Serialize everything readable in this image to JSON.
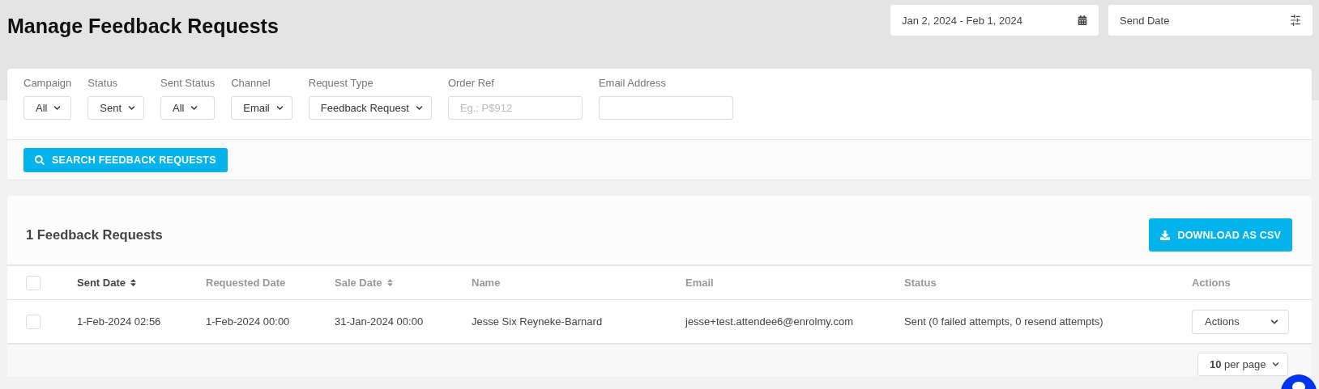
{
  "page": {
    "title": "Manage Feedback Requests"
  },
  "date_range": {
    "value": "Jan 2, 2024 - Feb 1, 2024"
  },
  "date_type": {
    "value": "Send Date"
  },
  "filters": [
    {
      "kind": "select",
      "label": "Campaign",
      "value": "All"
    },
    {
      "kind": "select",
      "label": "Status",
      "value": "Sent"
    },
    {
      "kind": "select",
      "label": "Sent Status",
      "value": "All"
    },
    {
      "kind": "select",
      "label": "Channel",
      "value": "Email"
    },
    {
      "kind": "select",
      "label": "Request Type",
      "value": "Feedback Request"
    },
    {
      "kind": "text",
      "label": "Order Ref",
      "placeholder": "Eg.: P$912"
    },
    {
      "kind": "text",
      "label": "Email Address"
    }
  ],
  "search_button": "SEARCH FEEDBACK REQUESTS",
  "results": {
    "title": "1 Feedback Requests",
    "download_button": "DOWNLOAD AS CSV",
    "select_all": {
      "checked": false
    },
    "columns": [
      {
        "label": "Sent Date",
        "sortable": true,
        "active": true
      },
      {
        "label": "Requested Date",
        "sortable": false,
        "active": false
      },
      {
        "label": "Sale Date",
        "sortable": true,
        "active": false
      },
      {
        "label": "Name",
        "sortable": false,
        "active": false
      },
      {
        "label": "Email",
        "sortable": false,
        "active": false
      },
      {
        "label": "Status",
        "sortable": false,
        "active": false
      },
      {
        "label": "Actions",
        "sortable": false,
        "active": false
      }
    ],
    "rows": [
      {
        "checked": false,
        "cells": [
          "1-Feb-2024 02:56",
          "1-Feb-2024 00:00",
          "31-Jan-2024 00:00",
          "Jesse Six Reyneke-Barnard",
          "jesse+test.attendee6@enrolmy.com",
          "Sent (0 failed attempts, 0 resend attempts)"
        ],
        "action": "Actions"
      }
    ],
    "page_size": {
      "count": "10",
      "suffix": "per page"
    }
  }
}
